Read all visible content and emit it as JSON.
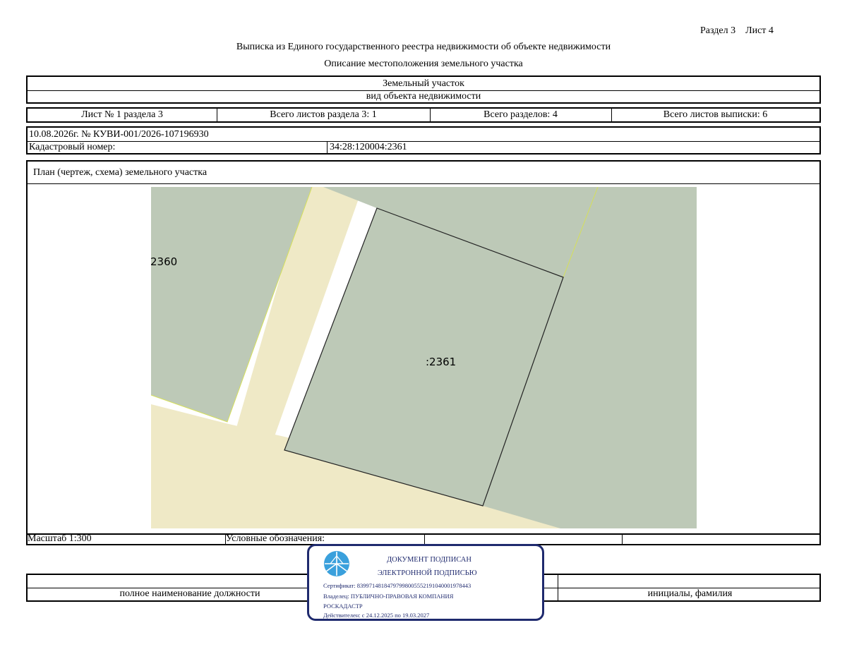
{
  "header": {
    "section_sheet": "Раздел 3    Лист 4",
    "title": "Выписка из Единого государственного реестра недвижимости об объекте недвижимости",
    "subtitle": "Описание местоположения земельного участка"
  },
  "object": {
    "type": "Земельный участок",
    "type_caption": "вид объекта недвижимости"
  },
  "sheets": {
    "sheet_no": "Лист № 1 раздела 3",
    "total_sheets_section": "Всего листов раздела 3: 1",
    "total_sections": "Всего разделов: 4",
    "total_sheets_extract": "Всего листов выписки: 6"
  },
  "record": {
    "date_number": "10.08.2026г. № КУВИ-001/2026-107196930",
    "cadastral_label": "Кадастровый номер:",
    "cadastral_value": "34:28:120004:2361"
  },
  "plan": {
    "title": "План (чертеж, схема) земельного участка",
    "label_neighbor": "2360",
    "label_main": ":2361",
    "colors": {
      "parcel": "#bdc9b7",
      "road": "#efe9c6",
      "boundary": "#222222",
      "edge": "#d6e05a"
    }
  },
  "legend": {
    "scale": "Масштаб 1:300",
    "legend_label": "Условные обозначения:"
  },
  "signature": {
    "position_caption": "полное наименование должности",
    "name_caption": "инициалы, фамилия"
  },
  "stamp": {
    "line1": "ДОКУМЕНТ ПОДПИСАН",
    "line2": "ЭЛЕКТРОННОЙ ПОДПИСЬЮ",
    "certificate": "Сертификат: 83997148184797998005552191040001978443",
    "owner": "Владелец: ПУБЛИЧНО-ПРАВОВАЯ КОМПАНИЯ",
    "owner2": "РОСКАДАСТР",
    "valid": "Действителен: с 24.12.2025 по 19.03.2027",
    "color": "#1f2a6e",
    "logo_color": "#3aa0dc",
    "logo_icon": "roskadastr-logo-icon"
  }
}
